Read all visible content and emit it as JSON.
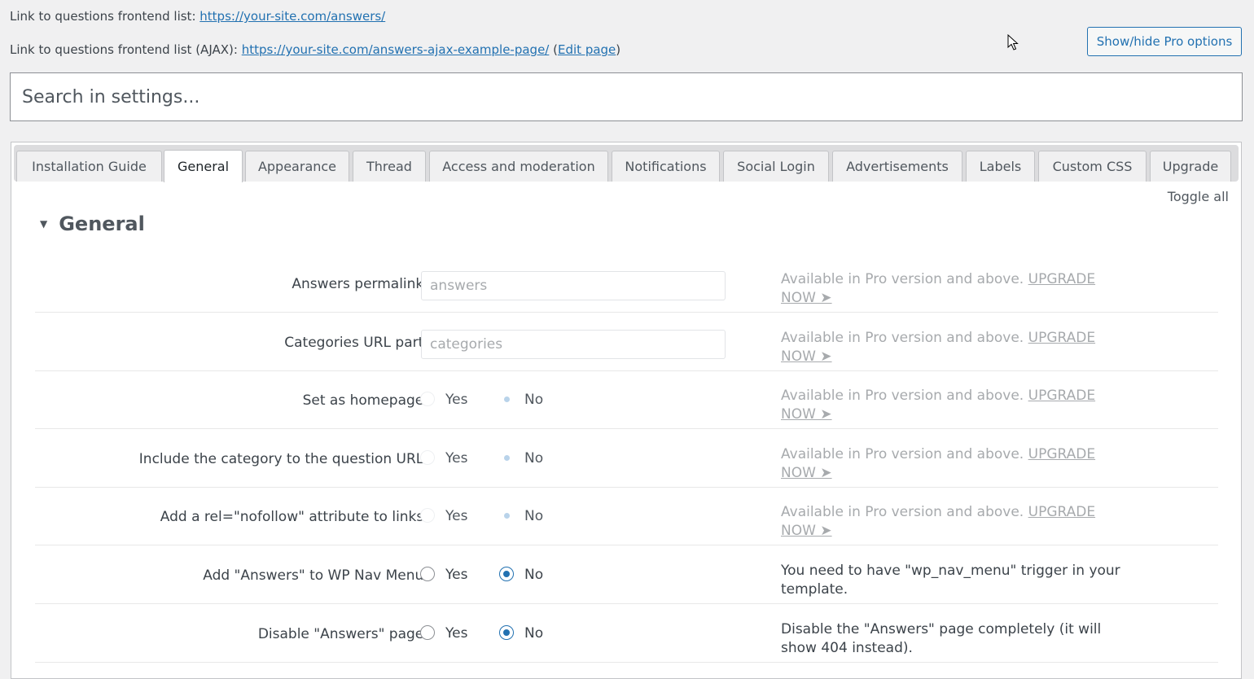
{
  "top_links": {
    "list_label": "Link to questions frontend list:",
    "list_url": "https://your-site.com/answers/",
    "ajax_label": "Link to questions frontend list (AJAX):",
    "ajax_url": "https://your-site.com/answers-ajax-example-page/",
    "open_paren": "(",
    "edit_page": "Edit page",
    "close_paren": ")"
  },
  "pro_toggle_label": "Show/hide Pro options",
  "search": {
    "placeholder": "Search in settings..."
  },
  "tabs": [
    {
      "label": "Installation Guide",
      "active": false
    },
    {
      "label": "General",
      "active": true
    },
    {
      "label": "Appearance",
      "active": false
    },
    {
      "label": "Thread",
      "active": false
    },
    {
      "label": "Access and moderation",
      "active": false
    },
    {
      "label": "Notifications",
      "active": false
    },
    {
      "label": "Social Login",
      "active": false
    },
    {
      "label": "Advertisements",
      "active": false
    },
    {
      "label": "Labels",
      "active": false
    },
    {
      "label": "Custom CSS",
      "active": false
    },
    {
      "label": "Upgrade",
      "active": false
    }
  ],
  "toggle_all": "Toggle all",
  "section": {
    "title": "General",
    "pro_note": "Available in Pro version and above.",
    "upgrade_line1": "UPGRADE",
    "upgrade_line2": "NOW ➤",
    "yes": "Yes",
    "no": "No",
    "rows": [
      {
        "label": "Answers permalink:",
        "value": "answers"
      },
      {
        "label": "Categories URL part:",
        "value": "categories"
      },
      {
        "label": "Set as homepage:",
        "selected": "No"
      },
      {
        "label": "Include the category to the question URL:",
        "selected": "No"
      },
      {
        "label": "Add a rel=\"nofollow\" attribute to links:",
        "selected": "No"
      },
      {
        "label": "Add \"Answers\" to WP Nav Menu:",
        "selected": "No",
        "note": "You need to have \"wp_nav_menu\" trigger in your template."
      },
      {
        "label": "Disable \"Answers\" page:",
        "selected": "No",
        "note": "Disable the \"Answers\" page completely (it will show 404 instead)."
      }
    ]
  },
  "colors": {
    "accent": "#2271b1",
    "muted": "#a7aaad",
    "background": "#f0f0f1"
  }
}
